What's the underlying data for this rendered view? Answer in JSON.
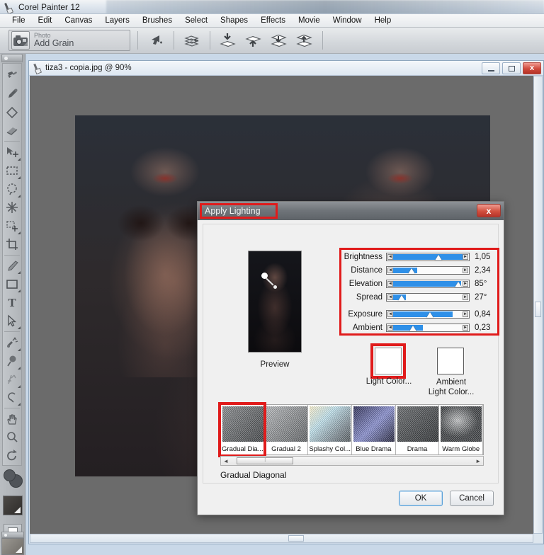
{
  "app": {
    "title": "Corel Painter 12",
    "logo_icon": "painter-logo-icon"
  },
  "menubar": {
    "items": [
      {
        "label": "File"
      },
      {
        "label": "Edit"
      },
      {
        "label": "Canvas"
      },
      {
        "label": "Layers"
      },
      {
        "label": "Brushes"
      },
      {
        "label": "Select"
      },
      {
        "label": "Shapes"
      },
      {
        "label": "Effects"
      },
      {
        "label": "Movie"
      },
      {
        "label": "Window"
      },
      {
        "label": "Help"
      }
    ]
  },
  "property_bar": {
    "brush_category": "Photo",
    "brush_variant": "Add Grain",
    "icons": [
      "undo-brushstroke-icon",
      "layer-commands-icon",
      "drop-down-layer-icon",
      "lift-up-layer-icon",
      "move-layer-down-icon",
      "move-layer-up-icon"
    ]
  },
  "toolbox": {
    "tools": [
      {
        "name": "brush-tool",
        "selected": false
      },
      {
        "name": "dropper-tool",
        "selected": false
      },
      {
        "name": "paint-bucket-tool",
        "selected": false
      },
      {
        "name": "eraser-tool",
        "selected": false
      },
      {
        "name": "layer-adjuster-tool",
        "selected": false
      },
      {
        "name": "rectangular-selection-tool",
        "selected": false
      },
      {
        "name": "lasso-tool",
        "selected": false
      },
      {
        "name": "magic-wand-tool",
        "selected": false
      },
      {
        "name": "selection-adjuster-tool",
        "selected": false
      },
      {
        "name": "crop-tool",
        "selected": false
      },
      {
        "name": "pen-tool",
        "selected": false
      },
      {
        "name": "rectangular-shape-tool",
        "selected": false
      },
      {
        "name": "text-tool",
        "selected": false
      },
      {
        "name": "shape-selection-tool",
        "selected": false
      },
      {
        "name": "cloner-tool",
        "selected": false
      },
      {
        "name": "dodge-tool",
        "selected": false
      },
      {
        "name": "divine-proportion-tool",
        "selected": false
      },
      {
        "name": "mirror-painting-tool",
        "selected": false
      },
      {
        "name": "grabber-hand-tool",
        "selected": false
      },
      {
        "name": "magnifier-tool",
        "selected": false
      },
      {
        "name": "rotate-page-tool",
        "selected": false
      }
    ],
    "color_swatches": "color-selector",
    "paper_well": "paper-selector",
    "screen_mode": "screen-mode-toggle",
    "paper_preview": "paper-texture-preview"
  },
  "document_window": {
    "title": "tiza3 - copia.jpg @ 90%",
    "minimize_label": "Minimize",
    "restore_label": "Restore",
    "close_label": "x"
  },
  "dialog": {
    "title": "Apply Lighting",
    "close_label": "x",
    "preview_label": "Preview",
    "light_color_label": "Light Color...",
    "ambient_color_label": "Ambient\nLight Color...",
    "ambient_color_line1": "Ambient",
    "ambient_color_line2": "Light Color...",
    "light_color_value": "#ffffff",
    "ambient_color_value": "#ffffff",
    "selected_preset_name": "Gradual Diagonal",
    "highlight_color": "#e01b1b",
    "slider_fill_color": "#2f90e8",
    "sliders": [
      {
        "label": "Brightness",
        "value": "1,05",
        "percent": 62
      },
      {
        "label": "Distance",
        "value": "2,34",
        "percent": 28
      },
      {
        "label": "Elevation",
        "value": "85°",
        "percent": 91
      },
      {
        "label": "Spread",
        "value": "27°",
        "percent": 16
      },
      {
        "label": "Exposure",
        "value": "0,84",
        "percent": 52
      },
      {
        "label": "Ambient",
        "value": "0,23",
        "percent": 30
      }
    ],
    "presets": [
      {
        "label": "Gradual Dia...",
        "selected": true
      },
      {
        "label": "Gradual 2",
        "selected": false
      },
      {
        "label": "Splashy Col...",
        "selected": false
      },
      {
        "label": "Blue Drama",
        "selected": false
      },
      {
        "label": "Drama",
        "selected": false
      },
      {
        "label": "Warm Globe",
        "selected": false
      }
    ],
    "buttons": {
      "ok": "OK",
      "cancel": "Cancel"
    }
  }
}
